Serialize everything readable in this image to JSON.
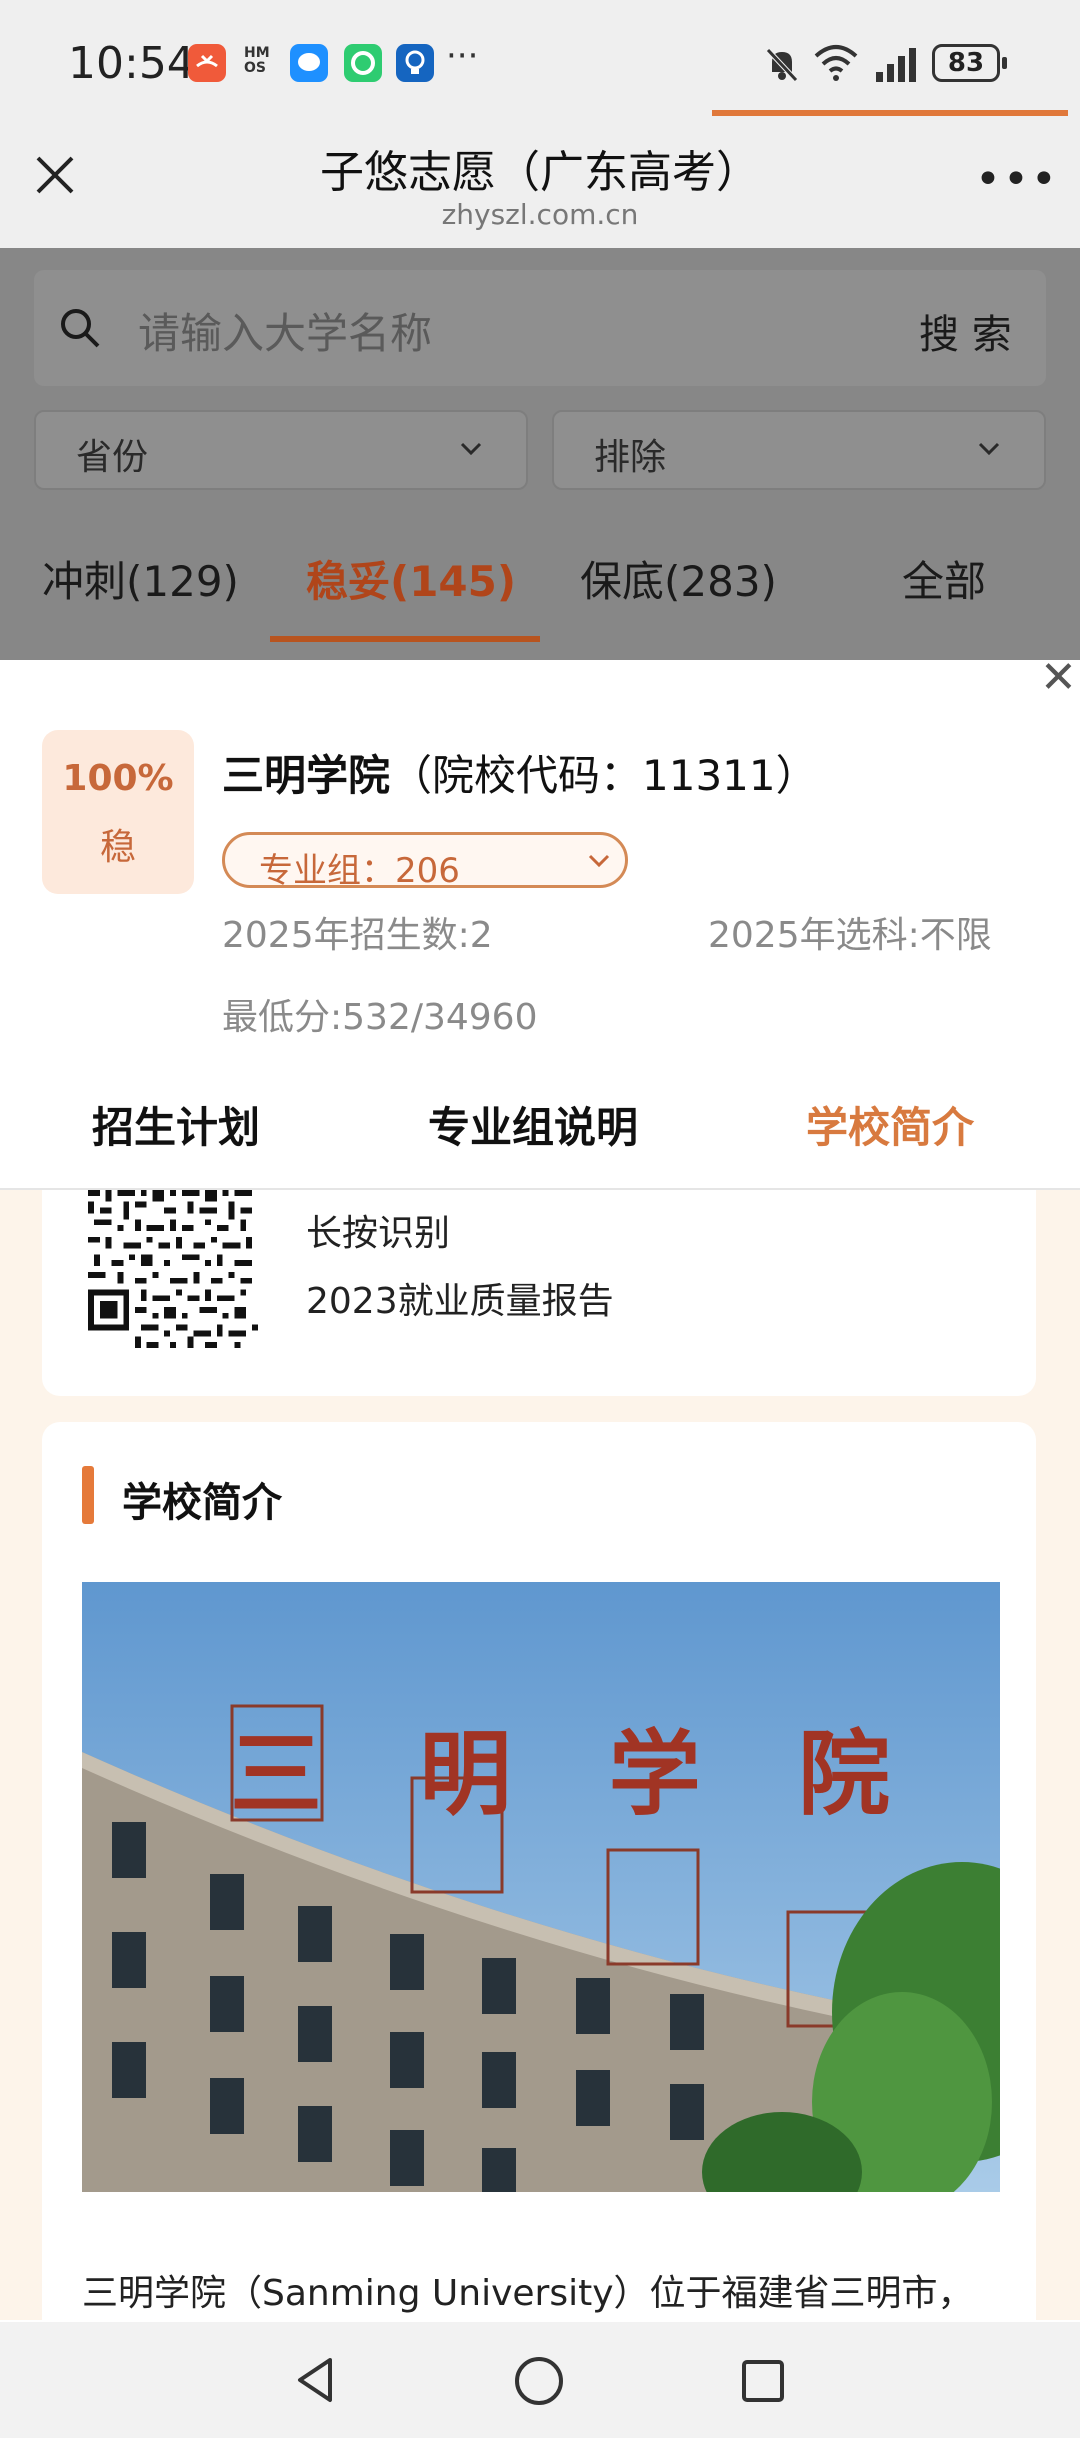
{
  "status_bar": {
    "time": "10:54",
    "battery": "83",
    "app_icons": [
      "call-missed-icon",
      "hms-icon",
      "message-app-icon",
      "chrome-app-icon",
      "lightbulb-app-icon"
    ],
    "system_icons": [
      "mute-icon",
      "wifi-icon",
      "signal-icon"
    ]
  },
  "browser": {
    "title": "子悠志愿（广东高考）",
    "url": "zhyszl.com.cn",
    "more": "•••"
  },
  "search": {
    "placeholder": "请输入大学名称",
    "button": "搜 索"
  },
  "filters": {
    "province": "省份",
    "exclude": "排除"
  },
  "risk_tabs": [
    {
      "label": "冲刺(129)"
    },
    {
      "label": "稳妥(145)",
      "active": true
    },
    {
      "label": "保底(283)"
    },
    {
      "label": "全部"
    }
  ],
  "school": {
    "prob": "100%",
    "level": "稳",
    "name": "三明学院",
    "code_text": "（院校代码：11311）",
    "group": "专业组：206",
    "enroll": "2025年招生数:2",
    "subject": "2025年选科:不限",
    "min_score": "最低分:532/34960"
  },
  "detail_tabs": [
    {
      "label": "招生计划"
    },
    {
      "label": "专业组说明"
    },
    {
      "label": "学校简介",
      "active": true
    }
  ],
  "qr_card": {
    "line1": "长按识别",
    "line2": "2023就业质量报告"
  },
  "intro": {
    "heading": "学校简介",
    "sign_chars": "三明学院",
    "paragraph": "三明学院（Sanming University）位于福建省三明市，"
  },
  "colors": {
    "accent": "#e0783a",
    "accent_text": "#c7683a",
    "badge_bg": "#fde9dc",
    "content_bg": "#fdf4ea"
  }
}
